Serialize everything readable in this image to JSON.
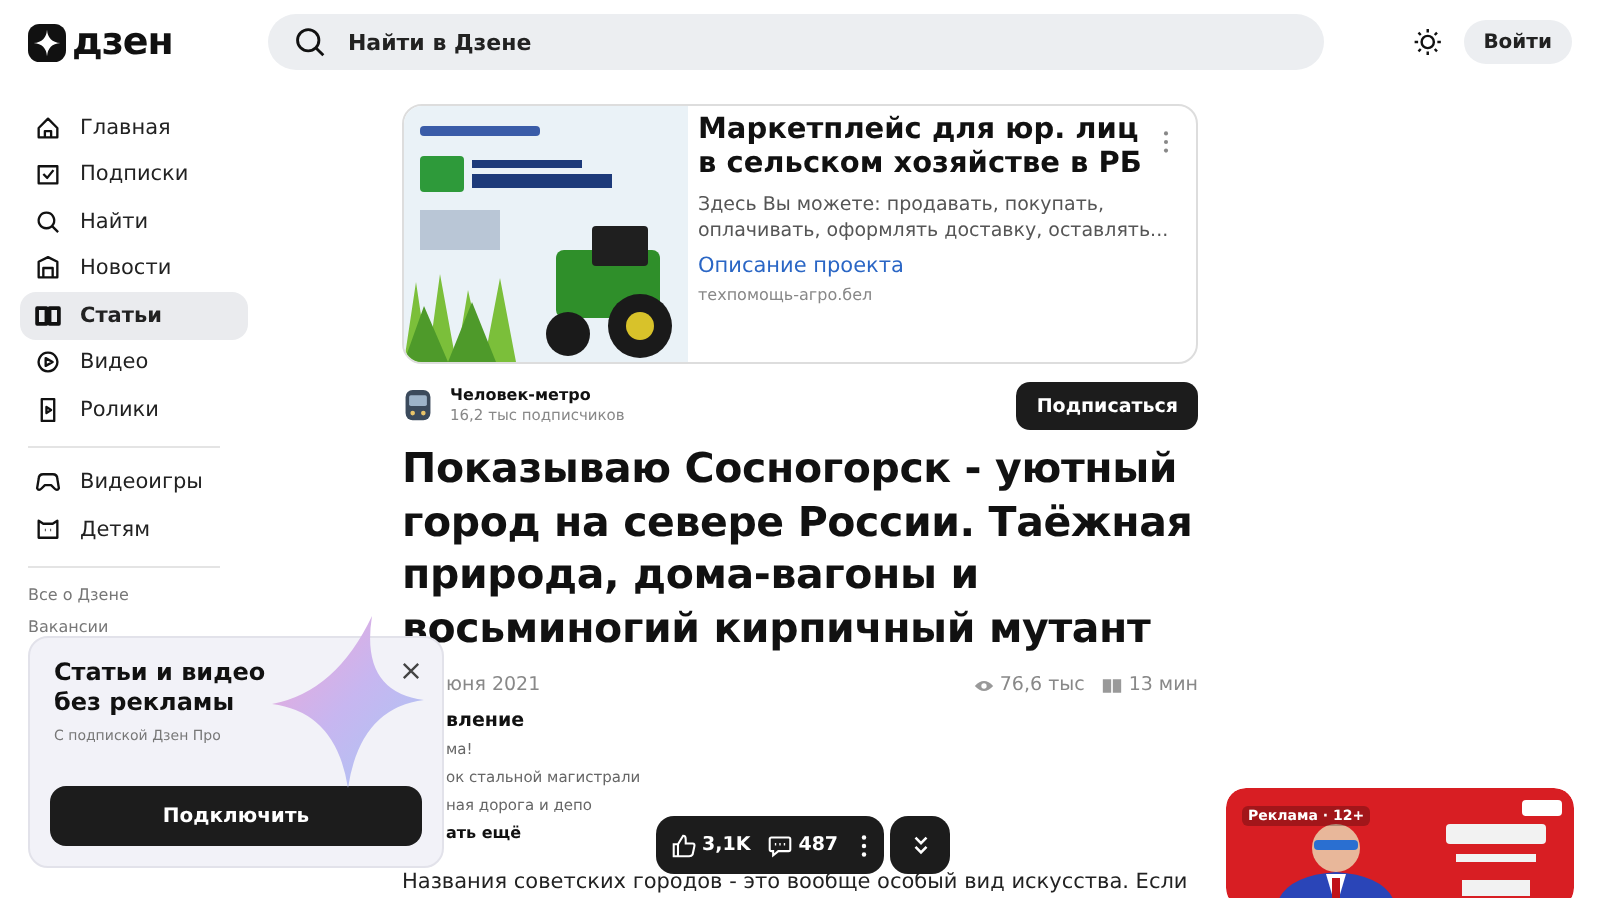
{
  "header": {
    "logo": "дзен",
    "search": {
      "placeholder": "Найти в Дзене"
    },
    "login": "Войти"
  },
  "sidebar": {
    "items": [
      {
        "label": "Главная",
        "selected": false
      },
      {
        "label": "Подписки",
        "selected": false
      },
      {
        "label": "Найти",
        "selected": false
      },
      {
        "label": "Новости",
        "selected": false
      },
      {
        "label": "Статьи",
        "selected": true
      },
      {
        "label": "Видео",
        "selected": false
      },
      {
        "label": "Ролики",
        "selected": false
      }
    ],
    "extra_items": [
      {
        "label": "Видеоигры",
        "selected": false
      },
      {
        "label": "Детям",
        "selected": false
      }
    ],
    "links": [
      "Все о Дзене",
      "Вакансии"
    ]
  },
  "ad": {
    "title": "Маркетплейс для юр. лиц в сельском хозяйстве в РБ",
    "text": "Здесь Вы можете: продавать, покупать, оплачивать, оформлять доставку, оставлять...",
    "link": "Описание проекта",
    "domain": "техпомощь-агро.бел"
  },
  "channel": {
    "name": "Человек-метро",
    "subscribers": "16,2 тыс подписчиков",
    "subscribe": "Подписаться"
  },
  "article": {
    "title": "Показываю Сосногорск - уютный город на севере России. Таёжная природа, дома-вагоны и восьминогий кирпичный мутант",
    "date": "юня 2021",
    "views": "76,6 тыс",
    "read_time": "13 мин",
    "toc": {
      "heading": "вление",
      "items": [
        "ма!",
        "ок стальной магистрали",
        "ная дорога и депо"
      ],
      "more": "ать ещё"
    },
    "paragraph": "Названия советских городов - это вообще особый вид искусства. Если"
  },
  "actions": {
    "likes": "3,1K",
    "comments": "487"
  },
  "promo": {
    "title": "Статьи и видео без рекламы",
    "subtitle": "С подпиской Дзен Про",
    "button": "Подключить"
  },
  "side_ad": {
    "label": "Реклама · 12+"
  }
}
